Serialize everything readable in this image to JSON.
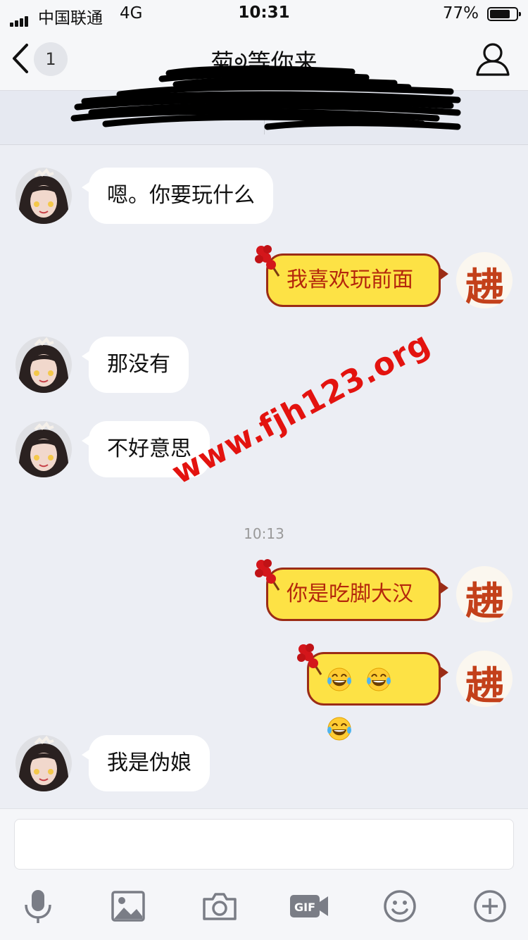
{
  "status_bar": {
    "carrier": "中国联通",
    "network": "4G",
    "time": "10:31",
    "battery_percent_label": "77%",
    "battery_level": 0.77
  },
  "nav": {
    "unread_count": "1",
    "title": "菊ᢀ等你来",
    "colors": {
      "accent": "#fde245",
      "accent_text": "#b4260c"
    }
  },
  "messages": [
    {
      "side": "left",
      "text": "嗯。你要玩什么"
    },
    {
      "side": "right",
      "text": "我喜欢玩前面",
      "avatar_char": "䞞"
    },
    {
      "side": "left",
      "text": "那没有"
    },
    {
      "side": "left",
      "text": "不好意思"
    },
    {
      "side": "divider",
      "text": "10:13"
    },
    {
      "side": "right",
      "text": "你是吃脚大汉",
      "avatar_char": "䞞"
    },
    {
      "side": "right",
      "emoji": [
        "face-with-tears-of-joy",
        "face-with-tears-of-joy",
        "face-with-tears-of-joy"
      ],
      "avatar_char": "䞞"
    },
    {
      "side": "left",
      "text": "我是伪娘"
    }
  ],
  "watermark": "www.fjh123.org",
  "toolbar": {
    "icons": [
      "microphone-icon",
      "image-icon",
      "camera-icon",
      "gif-icon",
      "smiley-icon",
      "plus-icon"
    ],
    "gif_label": "GIF"
  }
}
